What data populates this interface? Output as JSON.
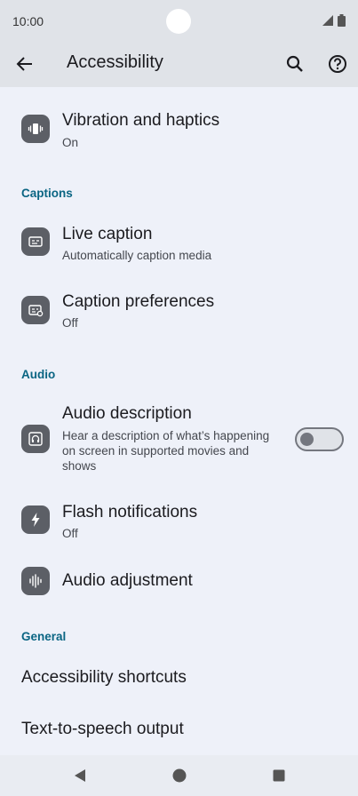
{
  "status": {
    "time": "10:00"
  },
  "header": {
    "title": "Accessibility"
  },
  "items": {
    "vibration": {
      "title": "Vibration and haptics",
      "sub": "On"
    },
    "live_caption": {
      "title": "Live caption",
      "sub": "Automatically caption media"
    },
    "caption_prefs": {
      "title": "Caption preferences",
      "sub": "Off"
    },
    "audio_description": {
      "title": "Audio description",
      "sub": "Hear a description of what’s happening on screen in supported movies and shows",
      "enabled": false
    },
    "flash": {
      "title": "Flash notifications",
      "sub": "Off"
    },
    "audio_adjustment": {
      "title": "Audio adjustment"
    },
    "shortcuts": {
      "title": "Accessibility shortcuts"
    },
    "tts": {
      "title": "Text-to-speech output"
    }
  },
  "sections": {
    "captions": "Captions",
    "audio": "Audio",
    "general": "General"
  },
  "colors": {
    "accent": "#0a6583",
    "icon_bg": "#5c5f66",
    "background": "#eef1f9",
    "bar": "#e0e3e8"
  }
}
